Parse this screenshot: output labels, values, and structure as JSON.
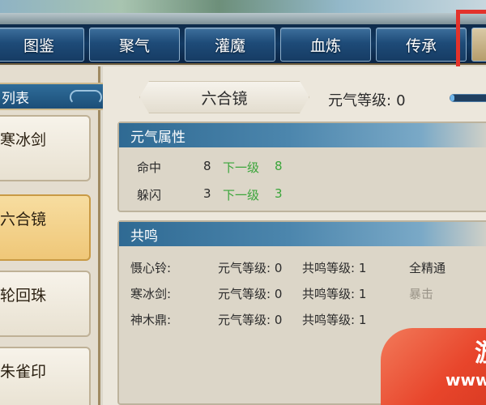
{
  "tabs": [
    {
      "label": "图鉴"
    },
    {
      "label": "聚气"
    },
    {
      "label": "灌魔"
    },
    {
      "label": "血炼"
    },
    {
      "label": "传承"
    },
    {
      "label": ""
    }
  ],
  "sidebar": {
    "header": "列表",
    "items": [
      {
        "label": "寒冰剑"
      },
      {
        "label": "六合镜"
      },
      {
        "label": "轮回珠"
      },
      {
        "label": "朱雀印"
      }
    ],
    "selected_index": 1
  },
  "main": {
    "item_name": "六合镜",
    "qi_level_label": "元气等级:",
    "qi_level_value": "0",
    "qi_progress_fraction": 0.08,
    "attributes": {
      "title": "元气属性",
      "rows": [
        {
          "name": "命中",
          "value": "8",
          "next_label": "下一级",
          "next_value": "8"
        },
        {
          "name": "躲闪",
          "value": "3",
          "next_label": "下一级",
          "next_value": "3"
        }
      ]
    },
    "resonance": {
      "title": "共鸣",
      "rows": [
        {
          "name": "慑心铃:",
          "qi": "元气等级: 0",
          "res": "共鸣等级: 1",
          "extra": "全精通"
        },
        {
          "name": "寒冰剑:",
          "qi": "元气等级: 0",
          "res": "共鸣等级: 1",
          "extra": "暴击"
        },
        {
          "name": "神木鼎:",
          "qi": "元气等级: 0",
          "res": "共鸣等级: 1",
          "extra": ""
        }
      ]
    }
  },
  "watermark": {
    "glyph": "游",
    "text": "www"
  },
  "colors": {
    "tab_blue": "#1e4b78",
    "active_item": "#efc778",
    "next_level_green": "#3aa53a",
    "highlight_red": "#e3322b"
  }
}
